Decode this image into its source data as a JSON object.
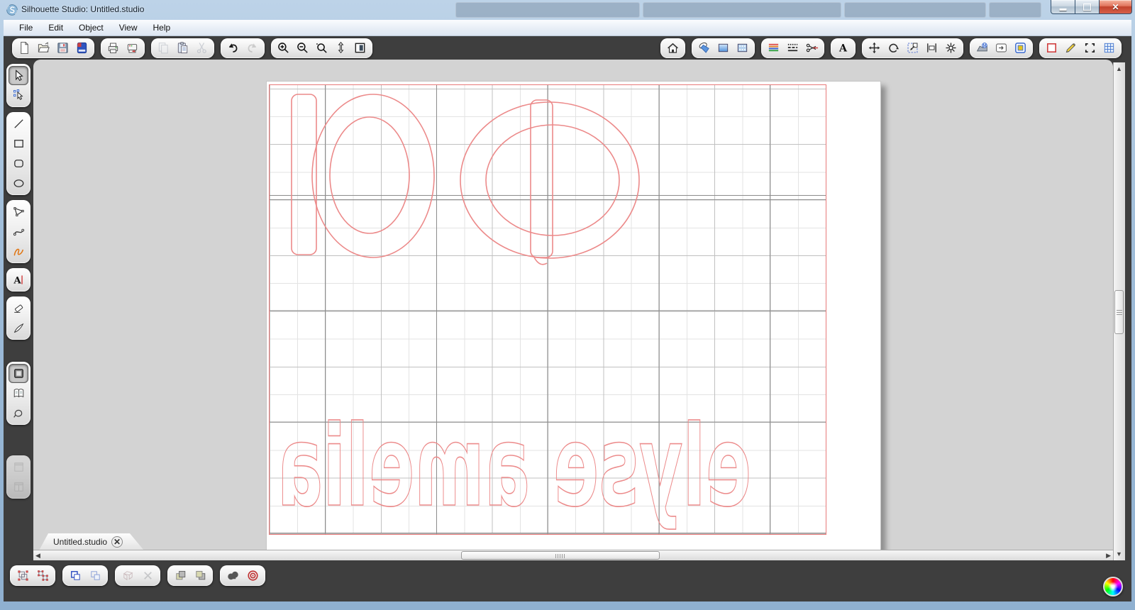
{
  "window": {
    "app_title": "Silhouette Studio: Untitled.studio",
    "controls": [
      "minimize",
      "maximize",
      "close"
    ]
  },
  "menu_bar": {
    "items": [
      "File",
      "Edit",
      "Object",
      "View",
      "Help"
    ]
  },
  "top_toolbar": {
    "left_groups": [
      [
        {
          "name": "new-document"
        },
        {
          "name": "open-file"
        },
        {
          "name": "save"
        },
        {
          "name": "save-to-library"
        }
      ],
      [
        {
          "name": "print"
        },
        {
          "name": "send-to-silhouette"
        }
      ],
      [
        {
          "name": "copy",
          "disabled": true
        },
        {
          "name": "paste"
        },
        {
          "name": "cut",
          "disabled": true
        }
      ],
      [
        {
          "name": "undo"
        },
        {
          "name": "redo",
          "disabled": true
        }
      ],
      [
        {
          "name": "zoom-in"
        },
        {
          "name": "zoom-out"
        },
        {
          "name": "zoom-selection"
        },
        {
          "name": "pan-zoom"
        },
        {
          "name": "fit-to-page"
        }
      ]
    ],
    "right_groups": [
      [
        {
          "name": "design-page-settings"
        }
      ],
      [
        {
          "name": "fill-color"
        },
        {
          "name": "fill-gradient"
        },
        {
          "name": "fill-pattern"
        }
      ],
      [
        {
          "name": "line-color"
        },
        {
          "name": "line-style"
        },
        {
          "name": "cut-style"
        }
      ],
      [
        {
          "name": "text-style"
        }
      ],
      [
        {
          "name": "move"
        },
        {
          "name": "rotate"
        },
        {
          "name": "scale"
        },
        {
          "name": "align"
        },
        {
          "name": "replicate"
        }
      ],
      [
        {
          "name": "modify"
        },
        {
          "name": "send-to-device"
        },
        {
          "name": "object-color"
        }
      ],
      [
        {
          "name": "registration-marks"
        },
        {
          "name": "sketch-pen"
        },
        {
          "name": "trace"
        },
        {
          "name": "grid-settings"
        }
      ]
    ]
  },
  "tool_sidebar": {
    "groups": [
      [
        {
          "name": "select",
          "active": true
        },
        {
          "name": "point-editing"
        }
      ],
      [
        {
          "name": "draw-line"
        },
        {
          "name": "draw-rectangle"
        },
        {
          "name": "draw-rounded-rectangle"
        },
        {
          "name": "draw-ellipse"
        }
      ],
      [
        {
          "name": "draw-polygon"
        },
        {
          "name": "draw-curve"
        },
        {
          "name": "draw-freehand"
        }
      ],
      [
        {
          "name": "text-tool"
        }
      ],
      [
        {
          "name": "eraser"
        },
        {
          "name": "knife"
        }
      ],
      [
        {
          "name": "design-page-view",
          "active": true
        },
        {
          "name": "library-view"
        },
        {
          "name": "send-view"
        }
      ],
      [
        {
          "name": "layout-single",
          "disabled": true
        },
        {
          "name": "layout-split",
          "disabled": true
        }
      ]
    ]
  },
  "bottom_toolbar": {
    "groups": [
      [
        {
          "name": "group"
        },
        {
          "name": "ungroup"
        }
      ],
      [
        {
          "name": "make-compound-path"
        },
        {
          "name": "release-compound-path"
        }
      ],
      [
        {
          "name": "weld",
          "disabled": true
        },
        {
          "name": "delete",
          "disabled": true
        }
      ],
      [
        {
          "name": "bring-to-front"
        },
        {
          "name": "send-to-back"
        }
      ],
      [
        {
          "name": "weld-selected"
        },
        {
          "name": "offset"
        }
      ]
    ]
  },
  "document_tabs": [
    {
      "label": "Untitled.studio",
      "active": true
    }
  ],
  "canvas": {
    "design_text": "elyse amelia",
    "mirrored": true,
    "outline_color": "#ec8a8a",
    "cut_border_color": "#e87a7a",
    "page_color": "#ffffff",
    "workspace_color": "#d3d3d3"
  }
}
